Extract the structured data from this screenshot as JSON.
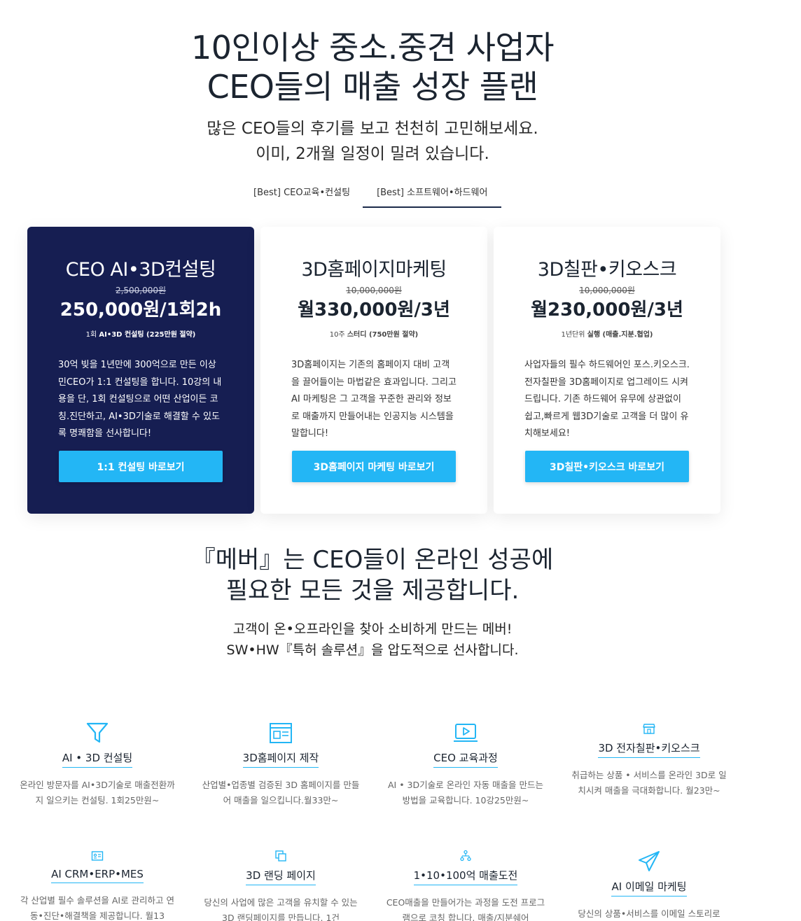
{
  "hero": {
    "title_line1": "10인이상 중소.중견 사업자",
    "title_line2": "CEO들의 매출 성장 플랜",
    "sub_line1": "많은 CEO들의 후기를 보고 천천히 고민해보세요.",
    "sub_line2": "이미, 2개월 일정이 밀려 있습니다."
  },
  "tabs": [
    {
      "label": "[Best] CEO교육•컨설팅"
    },
    {
      "label": "[Best] 소프트웨어•하드웨어"
    }
  ],
  "cards": [
    {
      "title": "CEO AI•3D컨설팅",
      "old_price": "2,500,000원",
      "price": "250,000원/1회2h",
      "note_pre": "1회 ",
      "note_bold": "AI•3D 컨설팅 (225만원 절약)",
      "desc": "30억 빚을 1년만에 300억으로 만든 이상민CEO가 1:1 컨설팅을 합니다. 10강의 내용을 단, 1회 컨설팅으로 어떤 산업이든 코칭.진단하고, AI•3D기술로 해결할 수 있도록 명쾌함을 선사합니다!",
      "button": "1:1 컨설팅 바로보기"
    },
    {
      "title": "3D홈페이지마케팅",
      "old_price": "10,000,000원",
      "price": "월330,000원/3년",
      "note_pre": "10주 ",
      "note_bold": "스터디 (750만원 절약)",
      "desc": "3D홈페이지는 기존의 홈페이지 대비 고객을 끌어들이는 마법같은 효과입니다. 그리고 AI 마케팅은 그 고객을 꾸준한 관리와 정보로 매출까지 만들어내는 인공지능 시스템을 말합니다!",
      "button": "3D홈페이지 마케팅 바로보기"
    },
    {
      "title": "3D칠판•키오스크",
      "old_price": "10,000,000원",
      "price": "월230,000원/3년",
      "note_pre": "1년단위 ",
      "note_bold": "실행 (매출.지분.협업)",
      "desc": "사업자들의 필수 하드웨어인 포스.키오스크.전자칠판을 3D홈페이지로 업그레이드 시켜드립니다. 기존 하드웨어 유무에 상관없이 쉽고,빠르게 웹3D기술로 고객을 더 많이 유치해보세요!",
      "button": "3D칠판•키오스크 바로보기"
    }
  ],
  "section2": {
    "title_line1": "『메버』는 CEO들이 온라인 성공에",
    "title_line2": "필요한 모든 것을 제공합니다.",
    "sub_line1": "고객이 온•오프라인을 찾아 소비하게 만드는 메버!",
    "sub_line2": "SW•HW『특허 솔루션』을 압도적으로 선사합니다."
  },
  "features": [
    {
      "name": "AI • 3D 컨설팅",
      "desc": "온라인 방문자를 AI•3D기술로 매출전환까지 일으키는 컨설팅. 1회25만원~",
      "icon": "filter-icon"
    },
    {
      "name": "3D홈페이지 제작",
      "desc": "산업별•업종별 검증된 3D 홈페이지를 만들어 매출을 일으킵니다.월33만~",
      "icon": "browser-icon"
    },
    {
      "name": "CEO 교육과정",
      "desc": "AI • 3D기술로 온라인 자동 매출을 만드는 방법을 교육합니다. 10강25만원~",
      "icon": "video-play-icon"
    },
    {
      "name": "3D 전자칠판•키오스크",
      "desc": "취급하는 상품 • 서비스를 온라인 3D로 일치시켜 매출을 극대화합니다. 월23만~",
      "icon": "store-icon"
    },
    {
      "name": "AI CRM•ERP•MES",
      "desc": "각 산업별 필수 솔루션을 AI로 관리하고 연동•진단•해결책을 제공합니다. 월13",
      "icon": "id-card-icon"
    },
    {
      "name": "3D 랜딩 페이지",
      "desc": "당신의 사업에 많은 고객을 유치할 수 있는 3D 랜딩페이지를 만듭니다. 1건",
      "icon": "copy-icon"
    },
    {
      "name": "1•10•100억 매출도전",
      "desc": "CEO매출을 만들어가는 과정을 도전 프로그램으로 코칭 합니다. 매출/지분쉐어",
      "icon": "network-icon"
    },
    {
      "name": "AI 이메일 마케팅",
      "desc": "당신의 상품•서비스를 이메일 스토리로",
      "icon": "paper-plane-icon"
    }
  ],
  "colors": {
    "accent": "#23b6f5",
    "navy": "#161e52"
  }
}
